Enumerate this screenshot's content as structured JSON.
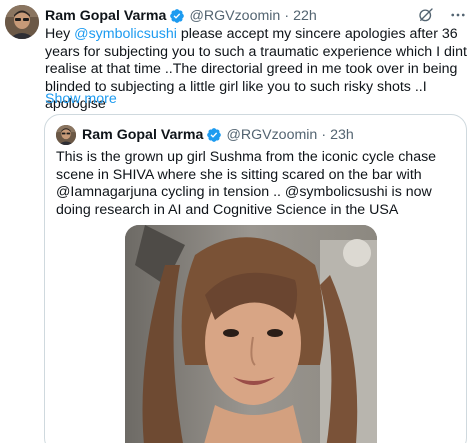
{
  "tweet": {
    "author_name": "Ram Gopal Varma",
    "author_handle": "@RGVzoomin",
    "separator": "·",
    "time": "22h",
    "text_before_mention": "Hey ",
    "mention": "@symbolicsushi",
    "text_after_mention": " please accept my sincere apologies after 36 years for subjecting you to such a traumatic experience which I dint realise at that time ..The directorial greed in me took over in being blinded to subjecting a little girl like you to such risky shots ..I apologise",
    "show_more": "Show more",
    "icons": [
      "grok-icon",
      "more-options-icon",
      "verified-badge-icon"
    ]
  },
  "quote": {
    "author_name": "Ram Gopal Varma",
    "author_handle": "@RGVzoomin",
    "separator": "·",
    "time": "23h",
    "text": "This is the grown up girl Sushma from the iconic cycle chase scene in SHIVA where she is sitting scared on the bar with @Iamnagarjuna cycling in tension  .. @symbolicsushi is now doing research in AI and Cognitive Science in the USA",
    "media": "photo"
  },
  "colors": {
    "accent": "#1d9bf0",
    "text": "#0f1419",
    "secondary": "#536471",
    "border": "#cfd9de"
  }
}
